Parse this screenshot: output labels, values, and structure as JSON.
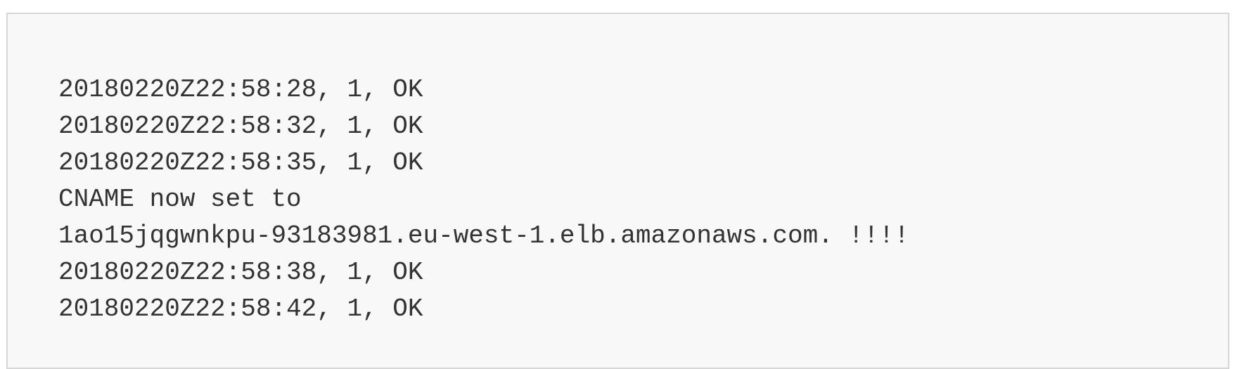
{
  "log": {
    "lines": [
      "20180220Z22:58:28, 1, OK",
      "20180220Z22:58:32, 1, OK",
      "20180220Z22:58:35, 1, OK",
      "CNAME now set to",
      "1ao15jqgwnkpu-93183981.eu-west-1.elb.amazonaws.com. !!!!",
      "20180220Z22:58:38, 1, OK",
      "20180220Z22:58:42, 1, OK"
    ]
  },
  "colors": {
    "text": "#333333",
    "background": "#f8f8f8",
    "border": "#d6d6d6"
  }
}
